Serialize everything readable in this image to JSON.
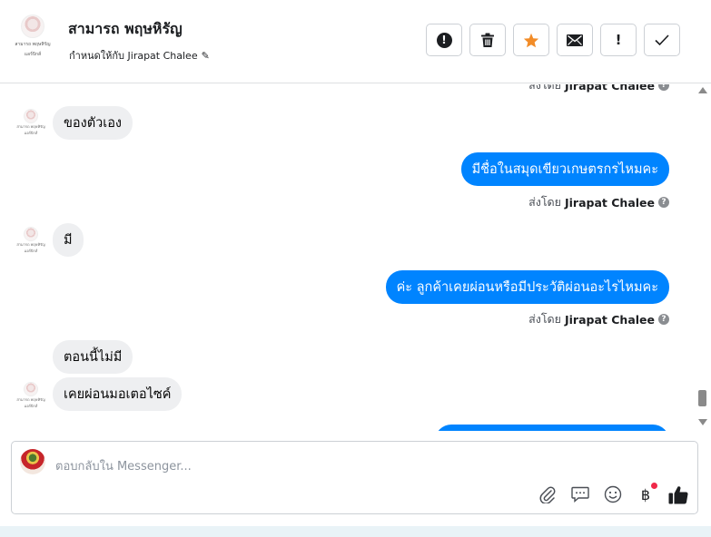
{
  "header": {
    "name": "สามารถ พฤษหิรัญ",
    "avatar_caption_1": "สามารถ พฤษหิรัญ",
    "avatar_caption_2": "แอร์บิกส์",
    "assign_text": "กำหนดให้กับ Jirapat Chalee",
    "actions": [
      "alert-circle-icon",
      "trash-icon",
      "star-icon",
      "envelope-icon",
      "exclamation-icon",
      "check-icon"
    ]
  },
  "messages": {
    "top_sent_prefix": "ส่งโดย",
    "top_sent_name": "Jirapat Chalee",
    "in_1": "ของตัวเอง",
    "out_1": "มีชื่อในสมุดเขียวเกษตรกรไหมคะ",
    "out_1_sent_prefix": "ส่งโดย",
    "out_1_sent_name": "Jirapat Chalee",
    "in_2": "มี",
    "out_2": "ค่ะ ลูกค้าเคยผ่อนหรือมีประวัติผ่อนอะไรไหมคะ",
    "out_2_sent_prefix": "ส่งโดย",
    "out_2_sent_name": "Jirapat Chalee",
    "in_3": "ตอนนี้ไม่มี",
    "in_4": "เคยผ่อนมอเตอไซค์",
    "mini_avatar_caption_1": "สามารถ พฤษหิรัญ",
    "mini_avatar_caption_2": "แอร์บิกส์",
    "info_icon_label": "?"
  },
  "composer": {
    "placeholder": "ตอบกลับใน Messenger...",
    "tools": [
      "paperclip-icon",
      "chat-bubble-icon",
      "smiley-icon",
      "baht-icon",
      "thumbs-up-icon"
    ]
  },
  "colors": {
    "outgoing": "#0084ff",
    "incoming": "#eeeff1",
    "star": "#f28c28",
    "notification_dot": "#f02849"
  }
}
